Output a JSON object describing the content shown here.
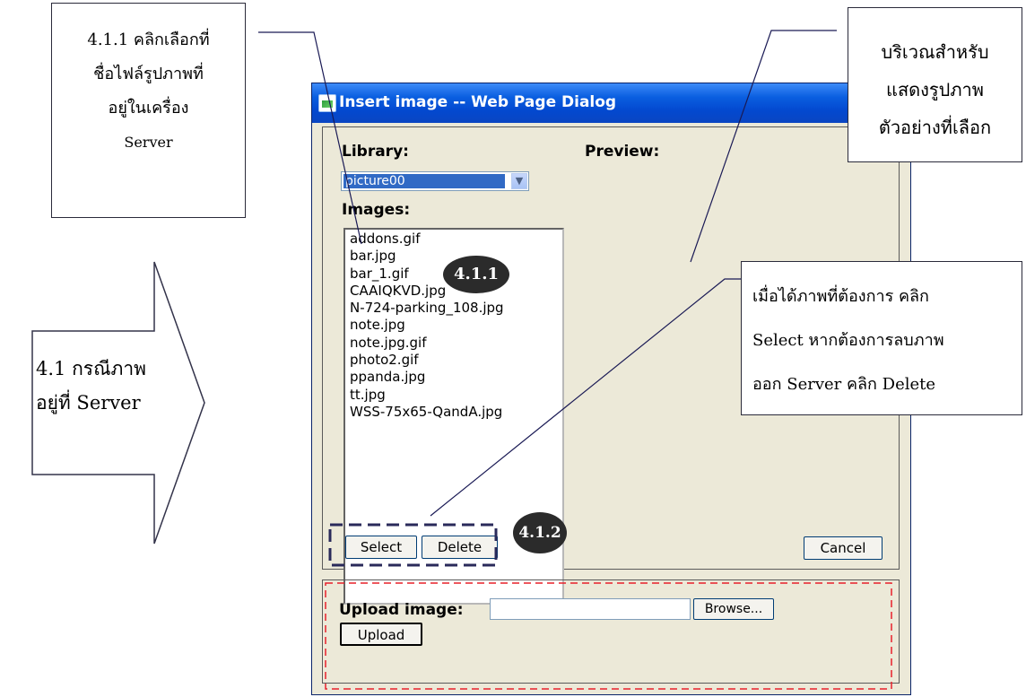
{
  "callouts": {
    "top_left": [
      "4.1.1 คลิกเลือกที่",
      "ชื่อไฟล์รูปภาพที่",
      "อยู่ในเครื่อง",
      "Server"
    ],
    "top_right": [
      "บริเวณสำหรับ",
      "แสดงรูปภาพ",
      "ตัวอย่างที่เลือก"
    ],
    "middle_right": [
      "เมื่อได้ภาพที่ต้องการ คลิก",
      "Select หากต้องการลบภาพ",
      "ออก Server คลิก Delete"
    ],
    "arrow": [
      "4.1 กรณีภาพ",
      "อยู่ที่  Server"
    ]
  },
  "badges": {
    "step_1": "4.1.1",
    "step_2": "4.1.2"
  },
  "dialog": {
    "title": "Insert image -- Web Page Dialog",
    "library_label": "Library:",
    "library_value": "picture00",
    "preview_label": "Preview:",
    "images_label": "Images:",
    "images": [
      "addons.gif",
      "bar.jpg",
      "bar_1.gif",
      "CAAIQKVD.jpg",
      "N-724-parking_108.jpg",
      "note.jpg",
      "note.jpg.gif",
      "photo2.gif",
      "ppanda.jpg",
      "tt.jpg",
      "WSS-75x65-QandA.jpg"
    ],
    "select_button": "Select",
    "delete_button": "Delete",
    "cancel_button": "Cancel",
    "upload_label": "Upload image:",
    "upload_value": "",
    "browse_button": "Browse...",
    "upload_button": "Upload"
  },
  "colors": {
    "titlebar": "#0a5ee0",
    "dialog_bg": "#ece9d8",
    "highlight_box": "#e8202a",
    "selection_box": "#2a2a5a",
    "badge": "#2b2b2b"
  }
}
